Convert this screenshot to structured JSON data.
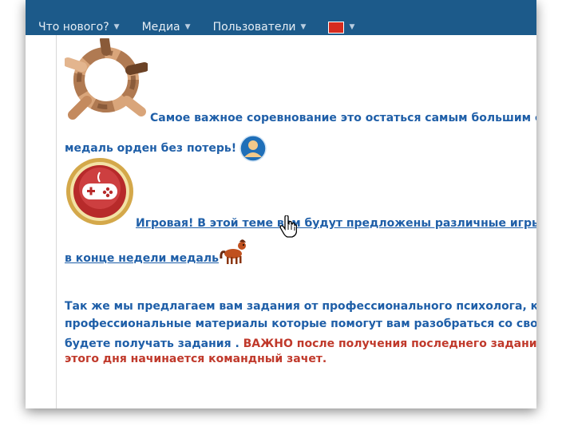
{
  "nav": {
    "items": [
      {
        "label": "Что нового?"
      },
      {
        "label": "Медиа"
      },
      {
        "label": "Пользователи"
      }
    ]
  },
  "post": {
    "paragraph1_line1": "Самое важное соревнование это остаться самым большим состав",
    "paragraph1_line2": "медаль орден без потерь!",
    "game_link_line1": "Игровая! В этой теме вам будут предложены различные игры , ",
    "game_link_line2": "в конце недели медаль ",
    "p3_line1": "Так же мы предлагаем вам задания от профессионального психолога, коуч",
    "p3_line2": "профессиональные материалы которые помогут вам разобраться со своей",
    "p3_line3_blue": "будете получать задания . ",
    "p3_line3_red": "ВАЖНО после получения последнего задания вы",
    "p3_line4_red": "этого дня начинается командный зачет."
  },
  "icons": {
    "hands_circle": "hands-circle-icon",
    "user_avatar": "user-avatar-icon",
    "gamepad_badge": "gamepad-badge-icon",
    "pony": "pony-icon",
    "cursor": "hand-pointer-cursor-icon"
  },
  "colors": {
    "nav_bg": "#1c5a8a",
    "text_blue": "#1f5fa8",
    "text_red": "#c0392b"
  }
}
